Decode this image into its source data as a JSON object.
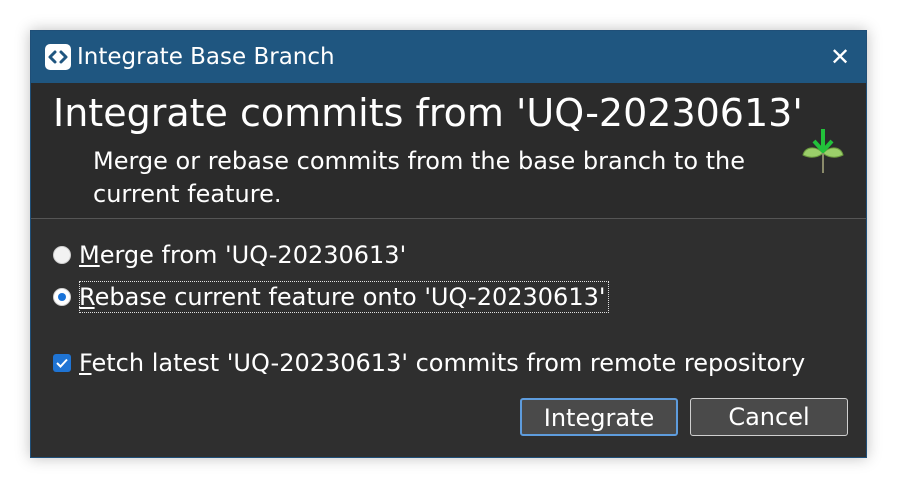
{
  "window": {
    "title": "Integrate Base Branch",
    "close_glyph": "✕"
  },
  "header": {
    "heading": "Integrate commits from 'UQ-20230613'",
    "description": "Merge or rebase commits from the base branch to the current feature.",
    "icon": "sprout-download-icon"
  },
  "options": {
    "merge": {
      "mnemonic": "M",
      "rest": "erge from 'UQ-20230613'",
      "selected": false
    },
    "rebase": {
      "mnemonic": "R",
      "rest": "ebase current feature onto 'UQ-20230613'",
      "selected": true
    },
    "fetch": {
      "mnemonic": "F",
      "rest": "etch latest 'UQ-20230613' commits from remote repository",
      "checked": true
    }
  },
  "buttons": {
    "integrate": "Integrate",
    "cancel": "Cancel"
  },
  "colors": {
    "titlebar": "#1f5680",
    "dialog_bg": "#2f2f2f",
    "accent": "#1a73d8"
  }
}
